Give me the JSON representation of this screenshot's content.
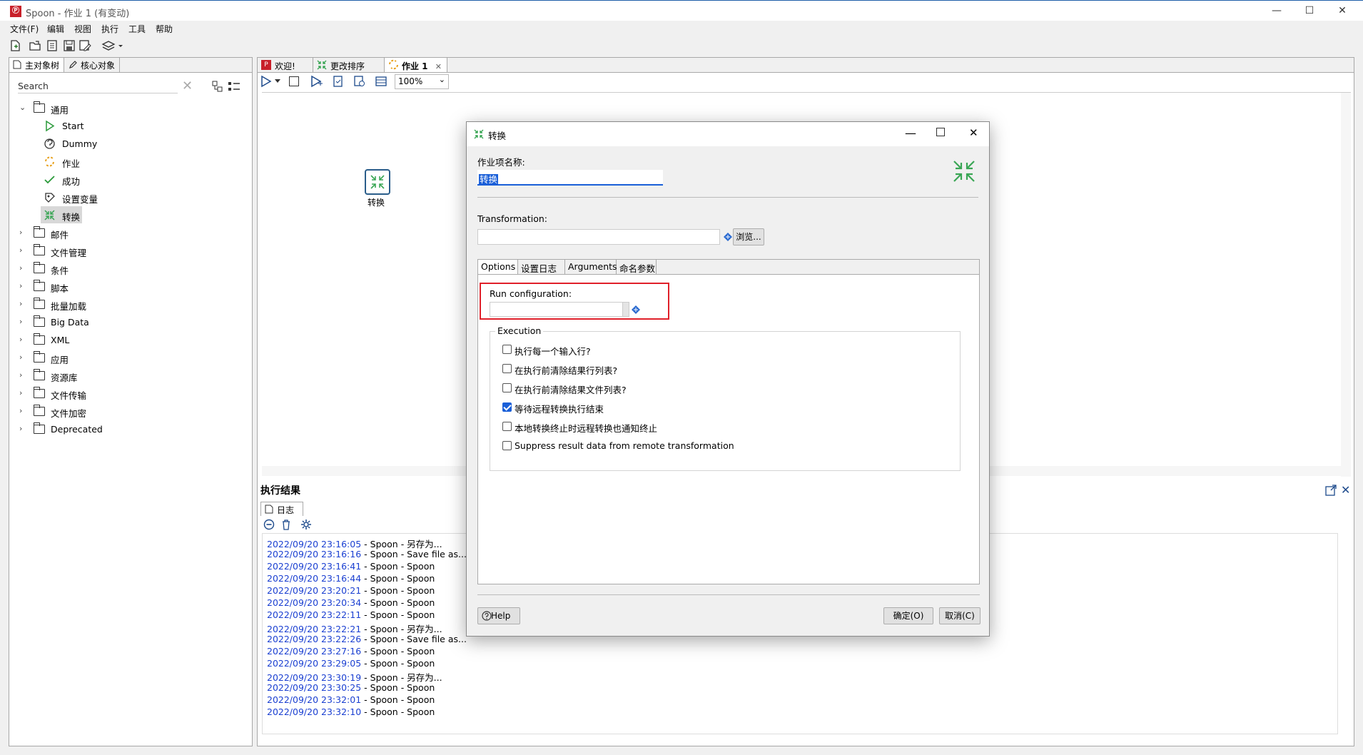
{
  "window": {
    "app_icon_text": "Ⓟ",
    "title": "Spoon - 作业 1 (有变动)",
    "minimize": "—",
    "maximize": "☐",
    "close": "✕"
  },
  "menubar": [
    "文件(F)",
    "编辑",
    "视图",
    "执行",
    "工具",
    "帮助"
  ],
  "left_panel": {
    "tabs": [
      "主对象树",
      "核心对象"
    ],
    "search_placeholder": "Search",
    "tree": [
      {
        "label": "通用",
        "expanded": true,
        "children": [
          {
            "label": "Start",
            "icon": "start-icon"
          },
          {
            "label": "Dummy",
            "icon": "dummy-icon"
          },
          {
            "label": "作业",
            "icon": "job-icon"
          },
          {
            "label": "成功",
            "icon": "success-icon"
          },
          {
            "label": "设置变量",
            "icon": "set-variable-icon"
          },
          {
            "label": "转换",
            "icon": "transformation-icon",
            "selected": true
          }
        ]
      },
      {
        "label": "邮件"
      },
      {
        "label": "文件管理"
      },
      {
        "label": "条件"
      },
      {
        "label": "脚本"
      },
      {
        "label": "批量加载"
      },
      {
        "label": "Big Data"
      },
      {
        "label": "XML"
      },
      {
        "label": "应用"
      },
      {
        "label": "资源库"
      },
      {
        "label": "文件传输"
      },
      {
        "label": "文件加密"
      },
      {
        "label": "Deprecated"
      }
    ]
  },
  "editor": {
    "tabs": [
      "欢迎!",
      "更改排序",
      "作业 1"
    ],
    "zoom": "100%",
    "canvas_node_label": "转换"
  },
  "results": {
    "header": "执行结果",
    "tab": "日志",
    "log": [
      {
        "ts": "2022/09/20 23:16:05",
        "msg": " - Spoon - 另存为..."
      },
      {
        "ts": "2022/09/20 23:16:16",
        "msg": " - Spoon - Save file as..."
      },
      {
        "ts": "2022/09/20 23:16:41",
        "msg": " - Spoon - Spoon"
      },
      {
        "ts": "2022/09/20 23:16:44",
        "msg": " - Spoon - Spoon"
      },
      {
        "ts": "2022/09/20 23:20:21",
        "msg": " - Spoon - Spoon"
      },
      {
        "ts": "2022/09/20 23:20:34",
        "msg": " - Spoon - Spoon"
      },
      {
        "ts": "2022/09/20 23:22:11",
        "msg": " - Spoon - Spoon"
      },
      {
        "ts": "2022/09/20 23:22:21",
        "msg": " - Spoon - 另存为..."
      },
      {
        "ts": "2022/09/20 23:22:26",
        "msg": " - Spoon - Save file as..."
      },
      {
        "ts": "2022/09/20 23:27:16",
        "msg": " - Spoon - Spoon"
      },
      {
        "ts": "2022/09/20 23:29:05",
        "msg": " - Spoon - Spoon"
      },
      {
        "ts": "2022/09/20 23:30:19",
        "msg": " - Spoon - 另存为..."
      },
      {
        "ts": "2022/09/20 23:30:25",
        "msg": " - Spoon - Spoon"
      },
      {
        "ts": "2022/09/20 23:32:01",
        "msg": " - Spoon - Spoon"
      },
      {
        "ts": "2022/09/20 23:32:10",
        "msg": " - Spoon - Spoon"
      }
    ]
  },
  "dialog": {
    "title": "转换",
    "name_label": "作业项名称:",
    "name_value": "转换",
    "transformation_label": "Transformation:",
    "transformation_value": "",
    "browse_button": "浏览...",
    "tabs": [
      "Options",
      "设置日志",
      "Arguments",
      "命名参数"
    ],
    "run_config_label": "Run configuration:",
    "run_config_value": "",
    "execution_label": "Execution",
    "checkboxes": [
      {
        "label": "执行每一个输入行?",
        "checked": false
      },
      {
        "label": "在执行前清除结果行列表?",
        "checked": false
      },
      {
        "label": "在执行前清除结果文件列表?",
        "checked": false
      },
      {
        "label": "等待远程转换执行结束",
        "checked": true
      },
      {
        "label": "本地转换终止时远程转换也通知终止",
        "checked": false
      },
      {
        "label": "Suppress result data from remote transformation",
        "checked": false
      }
    ],
    "help_button": "Help",
    "ok_button": "确定(O)",
    "cancel_button": "取消(C)",
    "highlight_color": "#e0202a"
  },
  "colors": {
    "accent": "#1a5fd8",
    "kettle_green": "#3aa655",
    "log_timestamp": "#1a3fd1"
  }
}
